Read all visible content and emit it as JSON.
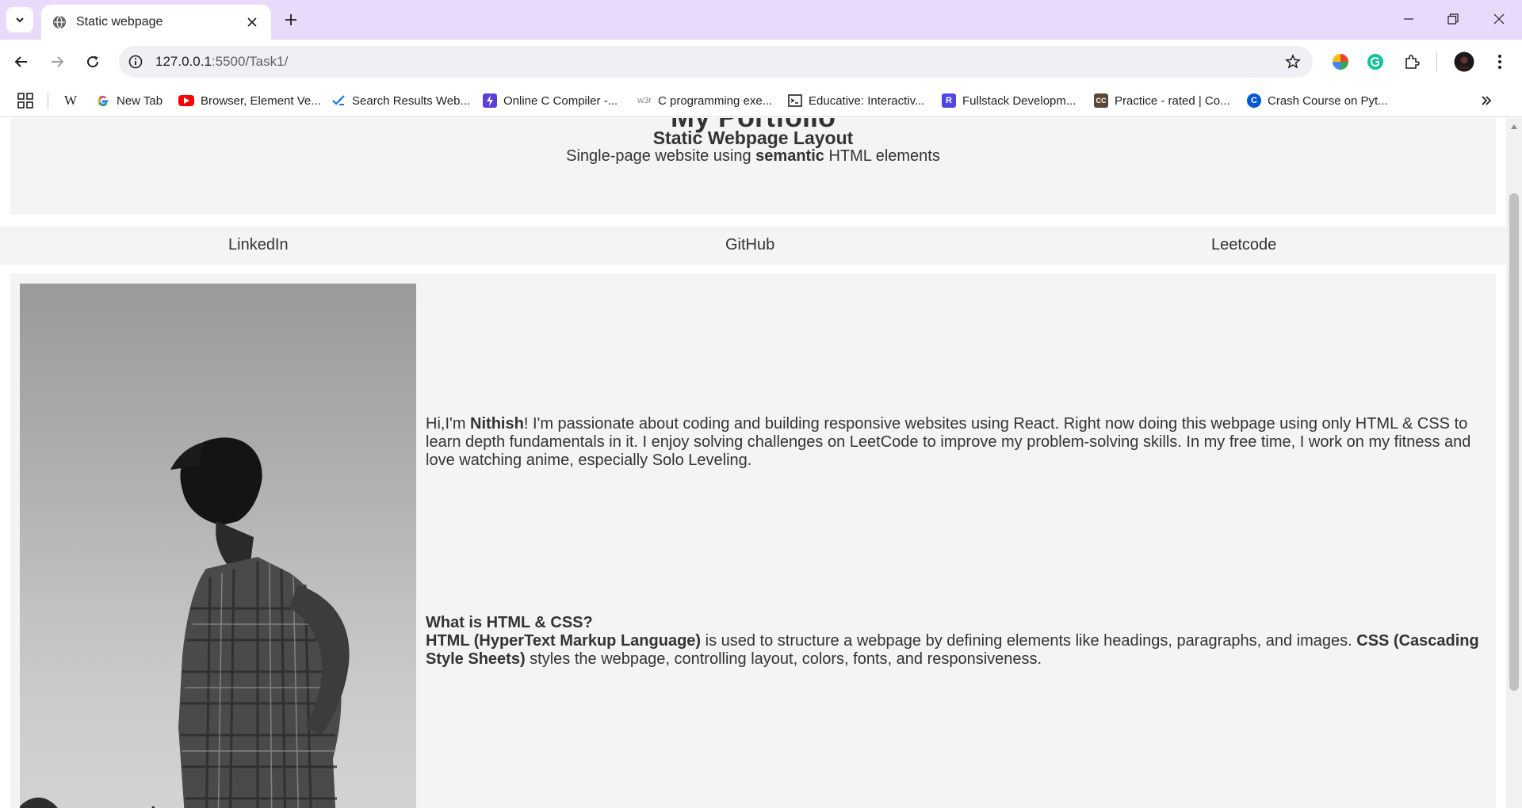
{
  "browser": {
    "tab_title": "Static webpage",
    "url_host": "127.0.0.1",
    "url_path": ":5500/Task1/",
    "bookmarks": [
      {
        "label": "",
        "icon": "wikipedia-icon"
      },
      {
        "label": "New Tab",
        "icon": "google-icon"
      },
      {
        "label": "Browser, Element Ve...",
        "icon": "youtube-icon"
      },
      {
        "label": "Search Results Web...",
        "icon": "checklist-icon"
      },
      {
        "label": "Online C Compiler -...",
        "icon": "bolt-icon"
      },
      {
        "label": "C programming exe...",
        "icon": "w3r-icon"
      },
      {
        "label": "Educative: Interactiv...",
        "icon": "educative-icon"
      },
      {
        "label": "Fullstack Developm...",
        "icon": "r-icon"
      },
      {
        "label": "Practice - rated | Co...",
        "icon": "codechef-icon"
      },
      {
        "label": "Crash Course on Pyt...",
        "icon": "coursera-icon"
      }
    ],
    "wiki_glyph": "W",
    "w3r_glyph": "w3r",
    "r_glyph": "R",
    "cc_glyph": "CC",
    "c_glyph": "C"
  },
  "page": {
    "header": {
      "heading": "My Portfolio",
      "subtitle": "Static Webpage Layout",
      "tagline_pre": "Single-page website using ",
      "tagline_bold": "semantic",
      "tagline_post": " HTML elements"
    },
    "nav": [
      "LinkedIn",
      "GitHub",
      "Leetcode"
    ],
    "about": {
      "pre": "Hi,I'm ",
      "name": "Nithish",
      "post": "! I'm passionate about coding and building responsive websites using React. Right now doing this webpage using only HTML & CSS to learn depth fundamentals in it. I enjoy solving challenges on LeetCode to improve my problem-solving skills. In my free time, I work on my fitness and love watching anime, especially Solo Leveling."
    },
    "qa": {
      "question": "What is HTML & CSS?",
      "html_term": "HTML (HyperText Markup Language)",
      "html_text": " is used to structure a webpage by defining elements like headings, paragraphs, and images. ",
      "css_term": "CSS (Cascading Style Sheets)",
      "css_text": " styles the webpage, controlling layout, colors, fonts, and responsiveness."
    }
  }
}
